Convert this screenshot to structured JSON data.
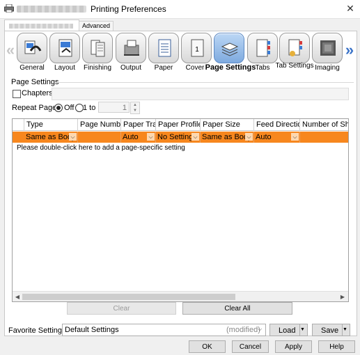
{
  "window": {
    "title": "Printing Preferences",
    "close_glyph": "✕"
  },
  "tabs": [
    {
      "label": ""
    },
    {
      "label": "Advanced"
    }
  ],
  "nav": {
    "left_arrow": "«",
    "right_arrow": "»"
  },
  "categories": [
    {
      "label": "General",
      "icon": "general-icon"
    },
    {
      "label": "Layout",
      "icon": "layout-icon"
    },
    {
      "label": "Finishing",
      "icon": "finishing-icon"
    },
    {
      "label": "Output",
      "icon": "output-icon"
    },
    {
      "label": "Paper",
      "icon": "paper-icon"
    },
    {
      "label": "Cover",
      "icon": "cover-icon"
    },
    {
      "label": "Page Settings",
      "icon": "page-settings-icon",
      "selected": true
    },
    {
      "label": "Tabs",
      "icon": "tabs-icon"
    },
    {
      "label": "Tab Settings",
      "icon": "tab-settings-icon"
    },
    {
      "label": "Imaging",
      "icon": "imaging-icon"
    }
  ],
  "page_settings": {
    "group_title": "Page Settings",
    "chapters_label": "Chapters",
    "chapters_checked": false,
    "repeat_label": "Repeat Pages",
    "off_label": "Off",
    "one_to_label": "1 to",
    "repeat_value": "1",
    "selected_option": "Off"
  },
  "table": {
    "columns": [
      "Type",
      "Page Number",
      "Paper Tray",
      "Paper Profile",
      "Paper Size",
      "Feed Direction",
      "Number of She"
    ],
    "row": [
      "Same as Body",
      "",
      "Auto",
      "No Setting",
      "Same as Body",
      "Auto",
      ""
    ],
    "hint": "Please double-click here to add a page-specific setting",
    "row_color": "#f7871e"
  },
  "actions": {
    "clear": "Clear",
    "clear_all": "Clear All"
  },
  "favorite": {
    "label": "Favorite Setting",
    "value": "Default Settings",
    "modified": "(modified)",
    "load": "Load",
    "save": "Save"
  },
  "dialog": {
    "ok": "OK",
    "cancel": "Cancel",
    "apply": "Apply",
    "help": "Help"
  }
}
